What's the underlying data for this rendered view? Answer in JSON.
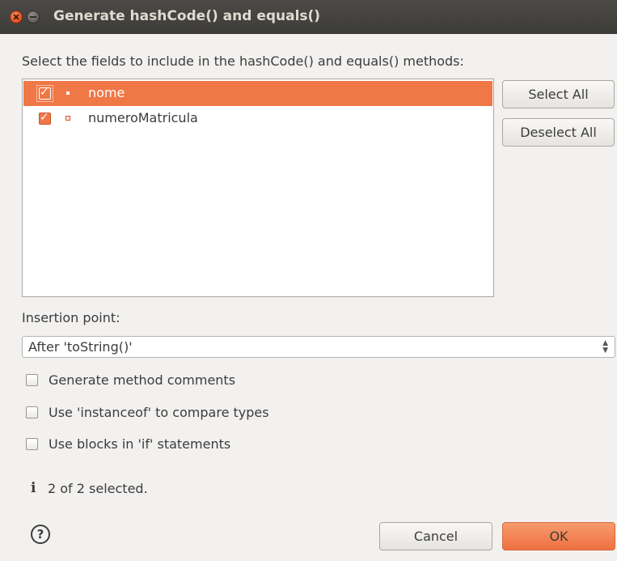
{
  "window": {
    "title": "Generate hashCode() and equals()"
  },
  "instruction": "Select the fields to include in the hashCode() and equals() methods:",
  "fields": [
    {
      "name": "nome",
      "checked": true,
      "selected": true
    },
    {
      "name": "numeroMatricula",
      "checked": true,
      "selected": false
    }
  ],
  "buttons": {
    "select_all": "Select All",
    "deselect_all": "Deselect All",
    "cancel": "Cancel",
    "ok": "OK",
    "help": "?"
  },
  "insertion_point": {
    "label": "Insertion point:",
    "value": "After 'toString()'"
  },
  "options": [
    {
      "label": "Generate method comments",
      "checked": false
    },
    {
      "label": "Use 'instanceof' to compare types",
      "checked": false
    },
    {
      "label": "Use blocks in 'if' statements",
      "checked": false
    }
  ],
  "status": {
    "icon": "i",
    "text": "2 of 2 selected."
  },
  "colors": {
    "accent": "#f07746",
    "title_bar": "#3d3c38",
    "background": "#f2f1f0"
  },
  "icons": {
    "close": "close-icon",
    "minimize": "minimize-icon",
    "field": "field-icon",
    "info": "info-icon",
    "help": "help-icon",
    "combo_arrows": "updown-arrow-icon"
  }
}
